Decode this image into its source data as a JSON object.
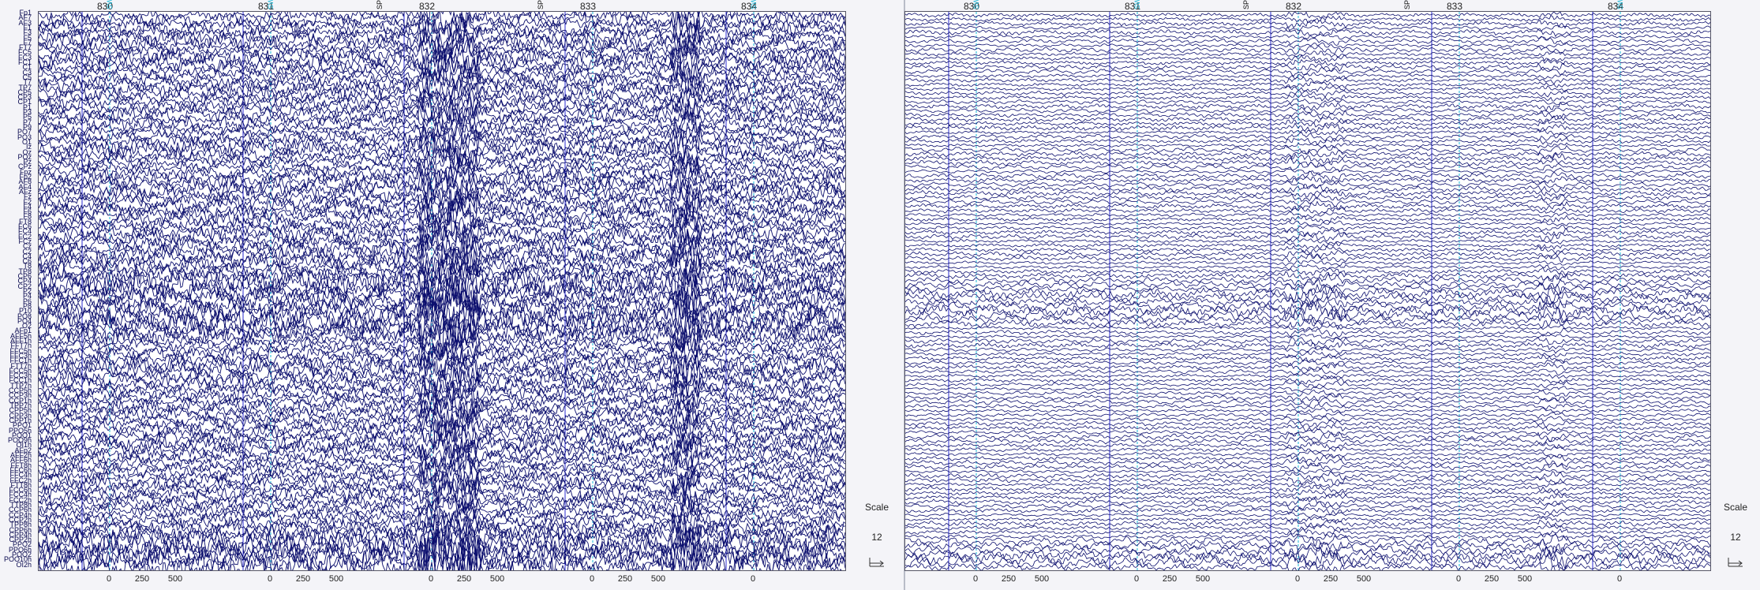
{
  "colors": {
    "trace": "#0c0f6e",
    "event_cyan": "#18b8d8",
    "event_blue": "#2a2ad0",
    "event_dark": "#111111",
    "background": "#ffffff"
  },
  "left_panel": {
    "seconds": [
      "830",
      "831",
      "832",
      "833",
      "834"
    ],
    "epoch_ticks": [
      "0",
      "250",
      "500"
    ],
    "markers": [
      {
        "label": "SW",
        "color": "#18b8d8"
      },
      {
        "label": "SW",
        "color": "#18b8d8"
      },
      {
        "label": "SP",
        "color": "#111111"
      },
      {
        "label": "SP",
        "color": "#111111"
      },
      {
        "label": "SW",
        "color": "#18b8d8"
      }
    ],
    "channel_labels": [
      "Fp1",
      "AF7",
      "AF3",
      "F1",
      "F3",
      "F5",
      "F7",
      "FT7",
      "FC5",
      "FC3",
      "FC1",
      "C1",
      "C3",
      "C5",
      "T7",
      "TP7",
      "CP5",
      "CP3",
      "CP1",
      "P1",
      "P3",
      "P5",
      "P7",
      "P9",
      "PO7",
      "PO3",
      "O1",
      "Iz",
      "Oz",
      "POz",
      "Pz",
      "CPz",
      "Fpz",
      "Fp2",
      "AF8",
      "AF4",
      "AFz",
      "Fz",
      "F2",
      "F4",
      "F6",
      "F8",
      "FT8",
      "FC6",
      "FC4",
      "FC2",
      "FCz",
      "Cz",
      "C2",
      "C4",
      "C6",
      "T8",
      "TP8",
      "CP6",
      "CP4",
      "CP2",
      "P2",
      "P4",
      "P6",
      "P8",
      "P10",
      "PO8",
      "PO4",
      "O2",
      "AFp1",
      "AFF5h",
      "AFF1h",
      "FFT7h",
      "FFC5h",
      "FFC3h",
      "FFC1h",
      "FTT7h",
      "FCC5h",
      "FCC3h",
      "FCC1h",
      "TTP7h",
      "CCP5h",
      "CCP3h",
      "CCP1h",
      "TPP7h",
      "CPP5h",
      "CPP3h",
      "CPP1h",
      "PPO1",
      "PPO5h",
      "POO1",
      "POO9h",
      "OI1h",
      "AFp2",
      "AFF2h",
      "AFF6h",
      "FFT8h",
      "FFC6h",
      "FFC4h",
      "FFC2h",
      "FTT8h",
      "FCC6h",
      "FCC4h",
      "FCC2h",
      "TTP8h",
      "CCP6h",
      "CCP4h",
      "CCP2h",
      "TPP8h",
      "CPP6h",
      "CPP4h",
      "CPP2h",
      "PPO2",
      "PPO6h",
      "POO2",
      "POO10h",
      "OI2h"
    ]
  },
  "right_panel": {
    "seconds": [
      "830",
      "831",
      "832",
      "833",
      "834"
    ],
    "epoch_ticks": [
      "0",
      "250",
      "500"
    ],
    "markers": [
      {
        "label": "SW",
        "color": "#18b8d8"
      },
      {
        "label": "SW",
        "color": "#18b8d8"
      },
      {
        "label": "SP",
        "color": "#111111"
      },
      {
        "label": "SP",
        "color": "#111111"
      },
      {
        "label": "SW",
        "color": "#18b8d8"
      }
    ]
  },
  "scale_panel": {
    "title": "Scale",
    "value": "12",
    "icon": "scale-adjust-icon"
  }
}
